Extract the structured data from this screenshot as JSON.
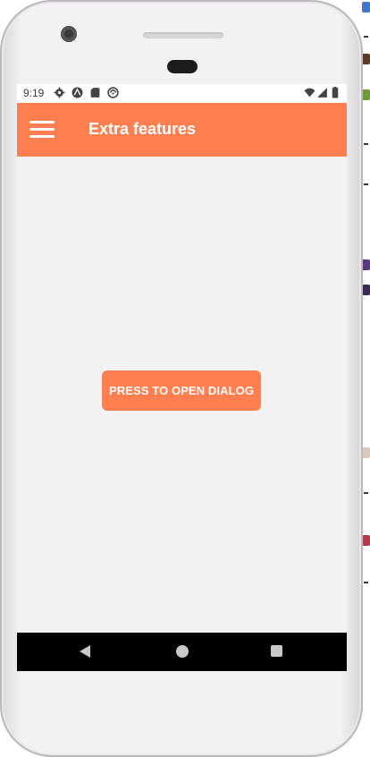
{
  "status_bar": {
    "time": "9:19",
    "left_icons": [
      "settings-icon",
      "android-icon",
      "sd-card-icon",
      "sync-icon"
    ],
    "right_icons": [
      "wifi-icon",
      "cell-signal-icon",
      "battery-icon"
    ]
  },
  "app_bar": {
    "menu_icon": "hamburger-menu-icon",
    "title": "Extra features"
  },
  "main": {
    "button_label": "PRESS TO OPEN DIALOG"
  },
  "nav_bar": {
    "buttons": [
      "back-icon",
      "home-icon",
      "recents-icon"
    ]
  },
  "colors": {
    "accent": "#ff7f50",
    "background": "#f2f2f2",
    "nav_bar": "#000000",
    "status_bar": "#ffffff"
  }
}
